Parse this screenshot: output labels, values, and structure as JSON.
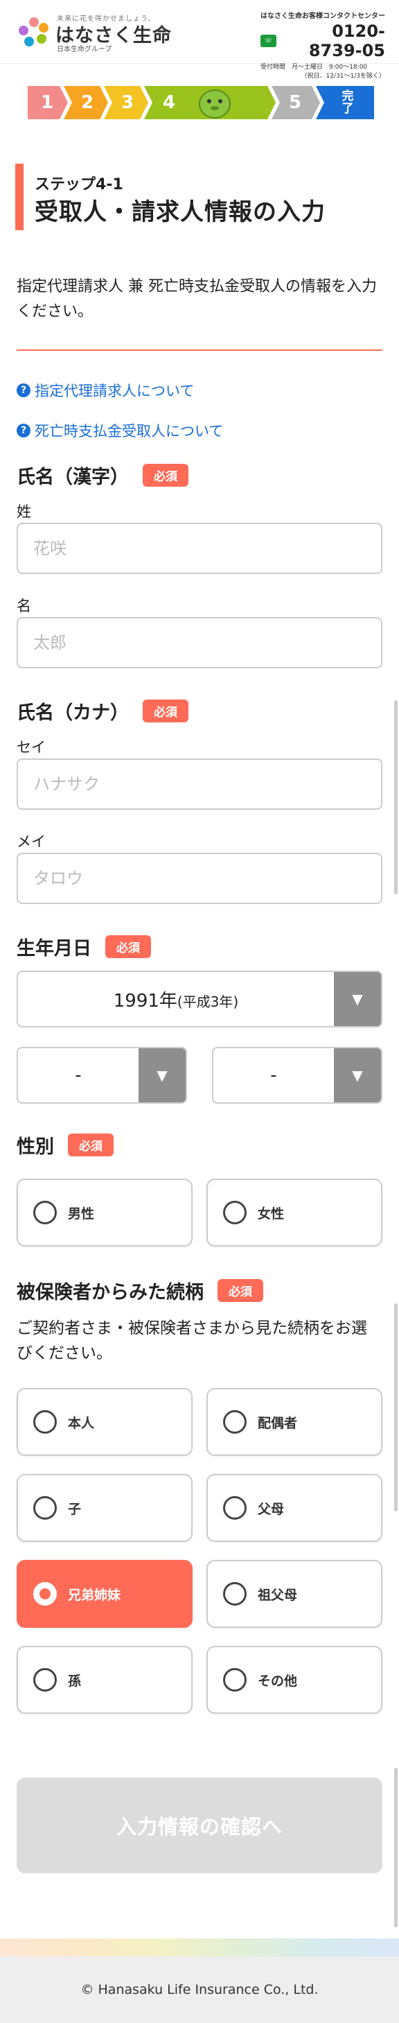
{
  "header": {
    "tagline": "未来に花を咲かせましょう。",
    "brand": "はなさく生命",
    "group": "日本生命グループ",
    "contact_title": "はなさく生命お客様コンタクトセンター",
    "freedial_icon": "freedial-icon",
    "phone": "0120-8739-05",
    "hours": "受付時間　月〜土曜日　9:00〜18:00",
    "hours_note": "（祝日、12/31〜1/3を除く）"
  },
  "steps": {
    "items": [
      "1",
      "2",
      "3",
      "4",
      "5",
      "完了"
    ],
    "current": 4,
    "colors": [
      "#f48b8b",
      "#f7a520",
      "#f3c322",
      "#99c31c",
      "#b3b3b3",
      "#1a6fd6"
    ]
  },
  "page": {
    "step_label": "ステップ4-1",
    "title": "受取人・請求人情報の入力",
    "intro": "指定代理請求人 兼 死亡時支払金受取人の情報を入力ください。"
  },
  "help_links": [
    {
      "icon": "help-icon",
      "label": "指定代理請求人について"
    },
    {
      "icon": "help-icon",
      "label": "死亡時支払金受取人について"
    }
  ],
  "required_badge": "必須",
  "name_kanji": {
    "label": "氏名（漢字）",
    "last_label": "姓",
    "last_placeholder": "花咲",
    "first_label": "名",
    "first_placeholder": "太郎"
  },
  "name_kana": {
    "label": "氏名（カナ）",
    "last_label": "セイ",
    "last_placeholder": "ハナサク",
    "first_label": "メイ",
    "first_placeholder": "タロウ"
  },
  "birthdate": {
    "label": "生年月日",
    "year_value": "1991年",
    "year_era": "(平成3年)",
    "month_value": "-",
    "day_value": "-"
  },
  "gender": {
    "label": "性別",
    "options": [
      "男性",
      "女性"
    ]
  },
  "relationship": {
    "label": "被保険者からみた続柄",
    "note": "ご契約者さま・被保険者さまから見た続柄をお選びください。",
    "options": [
      "本人",
      "配偶者",
      "子",
      "父母",
      "兄弟姉妹",
      "祖父母",
      "孫",
      "その他"
    ],
    "selected": "兄弟姉妹"
  },
  "confirm_button": "入力情報の確認へ",
  "footer": {
    "copyright": "© Hanasaku Life Insurance Co., Ltd."
  },
  "colors": {
    "accent": "#ff6b57",
    "link": "#1a6fd6",
    "disabled": "#dcdcdc"
  }
}
